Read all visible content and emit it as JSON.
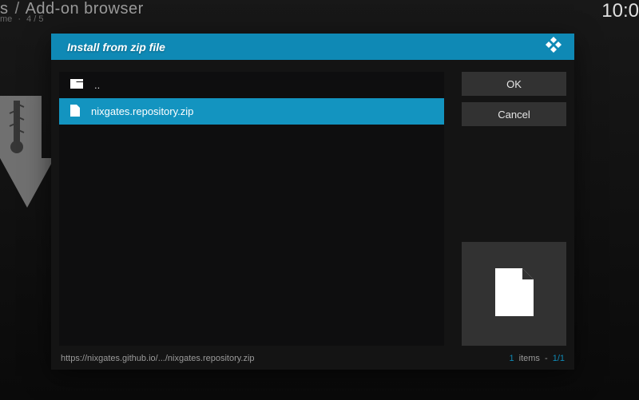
{
  "background": {
    "crumb_left": "s",
    "crumb_sep": "/",
    "crumb_right": "Add-on browser",
    "sub_left": "me",
    "sub_sep": "·",
    "sub_right": "4 / 5",
    "clock": "10:0"
  },
  "dialog": {
    "title": "Install from zip file",
    "files": {
      "up": {
        "label": ".."
      },
      "item": {
        "label": "nixgates.repository.zip"
      }
    },
    "buttons": {
      "ok": "OK",
      "cancel": "Cancel"
    },
    "footer": {
      "path": "https://nixgates.github.io/.../nixgates.repository.zip",
      "count": "1",
      "items_word": "items",
      "page_sep": "-",
      "page": "1/1"
    }
  }
}
